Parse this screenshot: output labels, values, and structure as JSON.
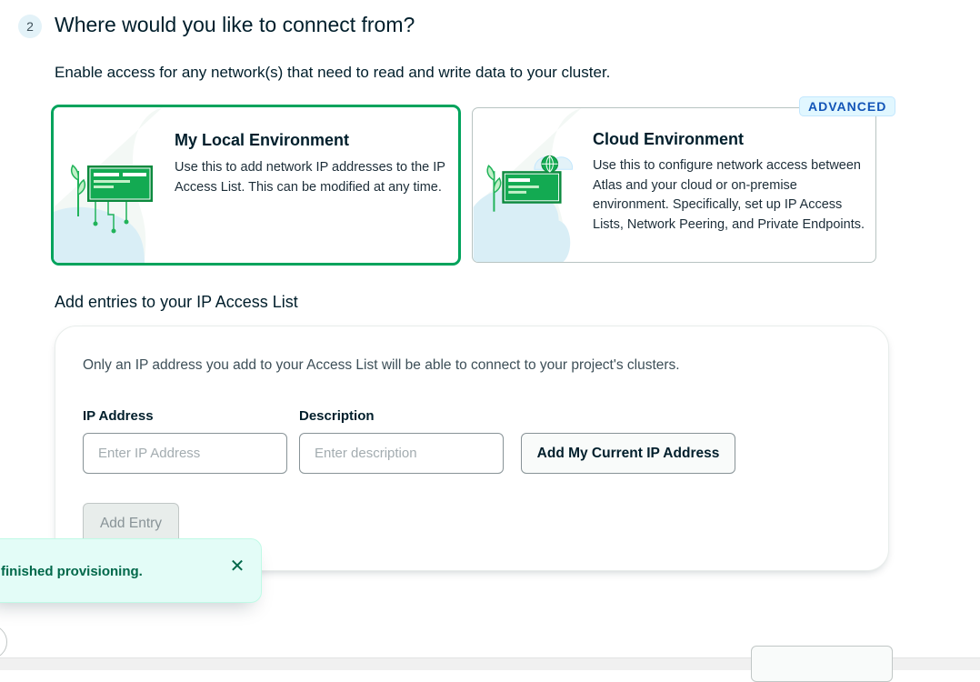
{
  "step": {
    "number": "2",
    "title": "Where would you like to connect from?",
    "description": "Enable access for any network(s) that need to read and write data to your cluster."
  },
  "environments": {
    "local": {
      "title": "My Local Environment",
      "text": "Use this to add network IP addresses to the IP Access List. This can be modified at any time.",
      "selected": true
    },
    "cloud": {
      "title": "Cloud Environment",
      "text": "Use this to configure network access between Atlas and your cloud or on-premise environment. Specifically, set up IP Access Lists, Network Peering, and Private Endpoints.",
      "badge": "ADVANCED"
    }
  },
  "access_list": {
    "heading": "Add entries to your IP Access List",
    "info": "Only an IP address you add to your Access List will be able to connect to your project's clusters.",
    "ip_label": "IP Address",
    "ip_placeholder": "Enter IP Address",
    "description_label": "Description",
    "description_placeholder": "Enter description",
    "add_current_ip_label": "Add My Current IP Address",
    "add_entry_label": "Add Entry"
  },
  "toast": {
    "message": "finished provisioning.",
    "close_icon": "x-icon"
  },
  "colors": {
    "accent_green": "#00a35c",
    "dark_green": "#00684a",
    "badge_blue": "#1254b7"
  }
}
